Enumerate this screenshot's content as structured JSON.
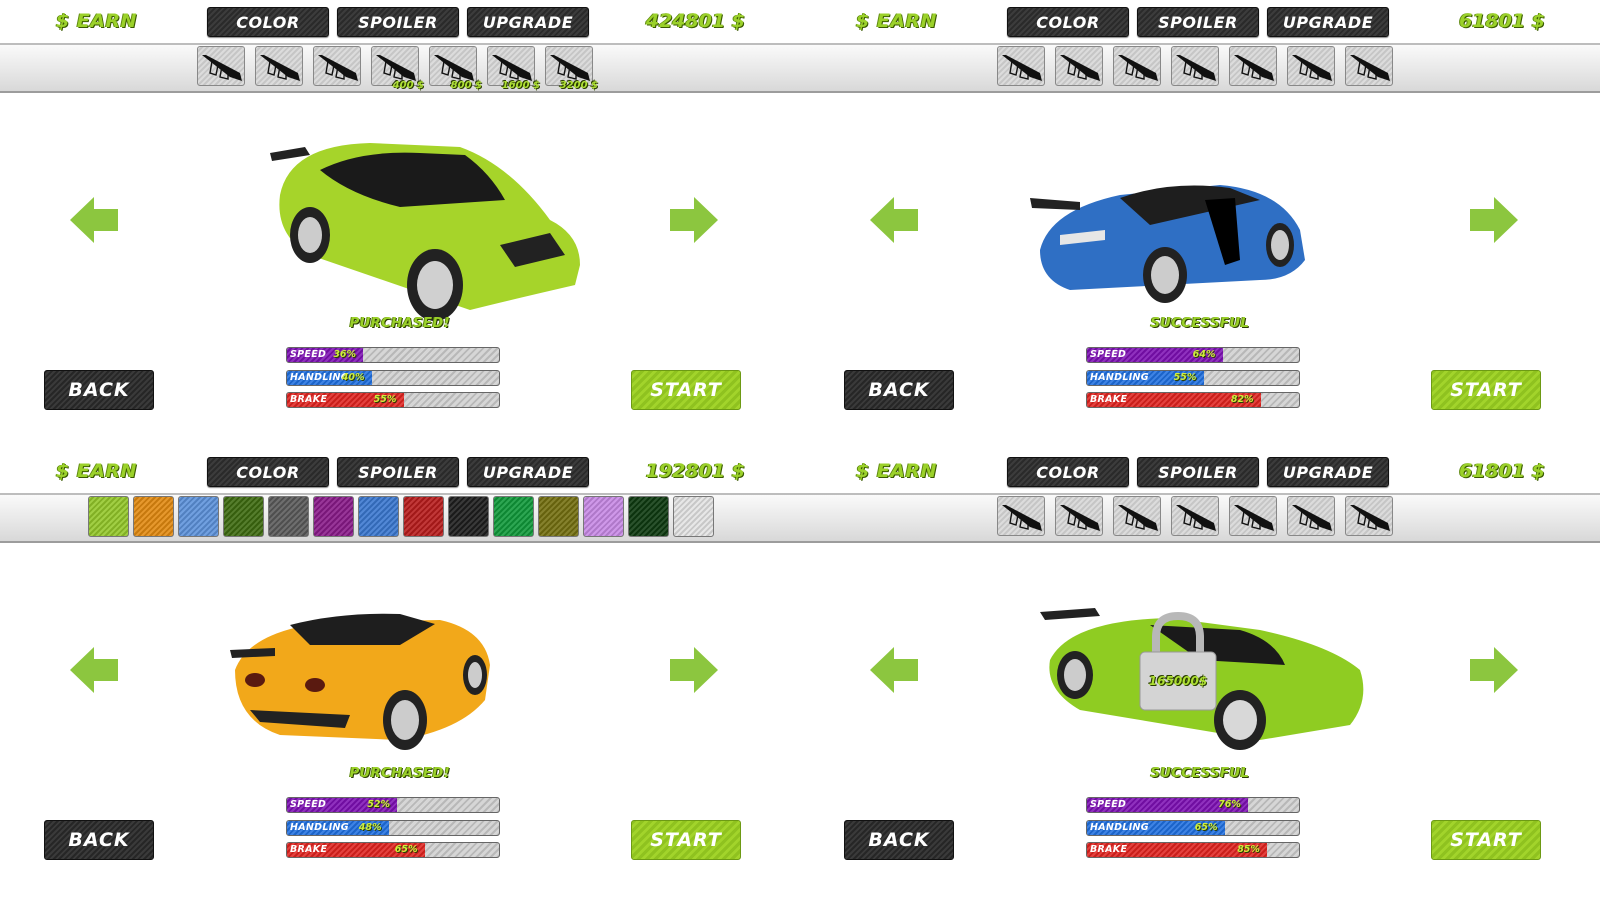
{
  "common": {
    "earn_label": "$ EARN",
    "tabs": [
      "COLOR",
      "SPOILER",
      "UPGRADE"
    ],
    "back_label": "BACK",
    "start_label": "START",
    "stat_labels": [
      "SPEED",
      "HANDLING",
      "BRAKE"
    ],
    "stat_colors": [
      "#7d0fb3",
      "#1f6fe0",
      "#e0221e"
    ],
    "accent": "#9bd12a"
  },
  "panels": [
    {
      "money": "424801 $",
      "active_tab": "SPOILER",
      "strip_type": "spoilers",
      "spoilers": [
        {
          "price": ""
        },
        {
          "price": ""
        },
        {
          "price": ""
        },
        {
          "price": "400 $"
        },
        {
          "price": "800 $"
        },
        {
          "price": "1600 $"
        },
        {
          "price": "3200 $"
        }
      ],
      "car": {
        "model": "suv",
        "color": "#a6d42a"
      },
      "status": "PURCHASED!",
      "stats": {
        "speed": 36,
        "handling": 40,
        "brake": 55
      },
      "stat_texts": [
        "36%",
        "40%",
        "55%"
      ]
    },
    {
      "money": "61801 $",
      "active_tab": "SPOILER",
      "strip_type": "spoilers",
      "spoilers": [
        {
          "price": ""
        },
        {
          "price": ""
        },
        {
          "price": ""
        },
        {
          "price": ""
        },
        {
          "price": ""
        },
        {
          "price": ""
        },
        {
          "price": ""
        }
      ],
      "car": {
        "model": "coupe-rear",
        "color": "#2f6fc4"
      },
      "status": "SUCCESSFUL",
      "stats": {
        "speed": 64,
        "handling": 55,
        "brake": 82
      },
      "stat_texts": [
        "64%",
        "55%",
        "82%"
      ]
    },
    {
      "money": "192801 $",
      "active_tab": "COLOR",
      "strip_type": "colors",
      "colors": [
        "#94c82a",
        "#e28a10",
        "#5d93dc",
        "#3e6b10",
        "#5a5a5a",
        "#8a1a8a",
        "#3a78d0",
        "#b81c1c",
        "#1e1e1e",
        "#109a3a",
        "#747010",
        "#c88ae6",
        "#0e3a10",
        "#e4e4e4"
      ],
      "car": {
        "model": "muscle-rear",
        "color": "#f2a81a"
      },
      "status": "PURCHASED!",
      "stats": {
        "speed": 52,
        "handling": 48,
        "brake": 65
      },
      "stat_texts": [
        "52%",
        "48%",
        "65%"
      ]
    },
    {
      "money": "61801 $",
      "active_tab": "SPOILER",
      "strip_type": "spoilers",
      "spoilers": [
        {
          "price": ""
        },
        {
          "price": ""
        },
        {
          "price": ""
        },
        {
          "price": ""
        },
        {
          "price": ""
        },
        {
          "price": ""
        },
        {
          "price": ""
        }
      ],
      "car": {
        "model": "supercar",
        "color": "#8fcc22"
      },
      "locked": true,
      "lock_price": "165000$",
      "status": "SUCCESSFUL",
      "stats": {
        "speed": 76,
        "handling": 65,
        "brake": 85
      },
      "stat_texts": [
        "76%",
        "65%",
        "85%"
      ]
    }
  ]
}
